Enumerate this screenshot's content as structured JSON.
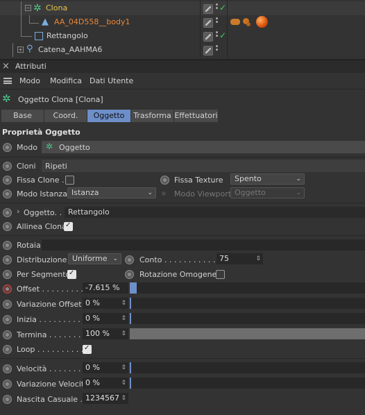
{
  "tree": {
    "rows": [
      {
        "name": "Clona",
        "color": "#e8c64a"
      },
      {
        "name": "AA_04D558__body1",
        "color": "#e8883a"
      },
      {
        "name": "Rettangolo",
        "color": "#d2d2d2"
      },
      {
        "name": "Catena_AAHMA6",
        "color": "#d2d2d2"
      }
    ]
  },
  "panel": {
    "title": "Attributi",
    "close": "×",
    "menu": [
      "Modo",
      "Modifica",
      "Dati Utente"
    ],
    "object_title": "Oggetto Clona [Clona]",
    "tabs": [
      "Base",
      "Coord.",
      "Oggetto",
      "Trasforma",
      "Effettuatori"
    ],
    "active_tab": "Oggetto",
    "section": "Proprietà Oggetto"
  },
  "props": {
    "modo_label": "Modo",
    "modo_value": "Oggetto",
    "cloni_label": "Cloni",
    "cloni_value": "Ripeti",
    "fissa_clone_label": "Fissa Clone .",
    "fissa_texture_label": "Fissa Texture",
    "fissa_texture_value": "Spento",
    "modo_istanza_label": "Modo Istanza",
    "modo_istanza_value": "Istanza",
    "modo_viewport_label": "Modo Viewport",
    "modo_viewport_value": "Oggetto",
    "oggetto_label": "Oggetto. .",
    "oggetto_value": "Rettangolo",
    "allinea_label": "Allinea Clona",
    "rotaia_label": "Rotaia",
    "distribuzione_label": "Distribuzione",
    "distribuzione_value": "Uniforme",
    "conto_label": "Conto . . . . . . . . . . .",
    "conto_value": "75",
    "per_segmento_label": "Per Segmento",
    "rotazione_label": "Rotazione Omogenea",
    "offset_label": "Offset . . . . . . . . .",
    "offset_value": "-7.615 %",
    "offset_fill": 0.02,
    "variazione_offset_label": "Variazione Offset",
    "variazione_offset_value": "0 %",
    "inizia_label": "Inizia . . . . . . . . . .",
    "inizia_value": "0 %",
    "termina_label": "Termina . . . . . . .",
    "termina_value": "100 %",
    "loop_label": "Loop . . . . . . . . . .",
    "velocita_label": "Velocità . . . . . . . .",
    "velocita_value": "0 %",
    "variazione_velocita_label": "Variazione Velocità",
    "variazione_velocita_value": "0 %",
    "nascita_label": "Nascita Casuale .",
    "nascita_value": "1234567"
  }
}
